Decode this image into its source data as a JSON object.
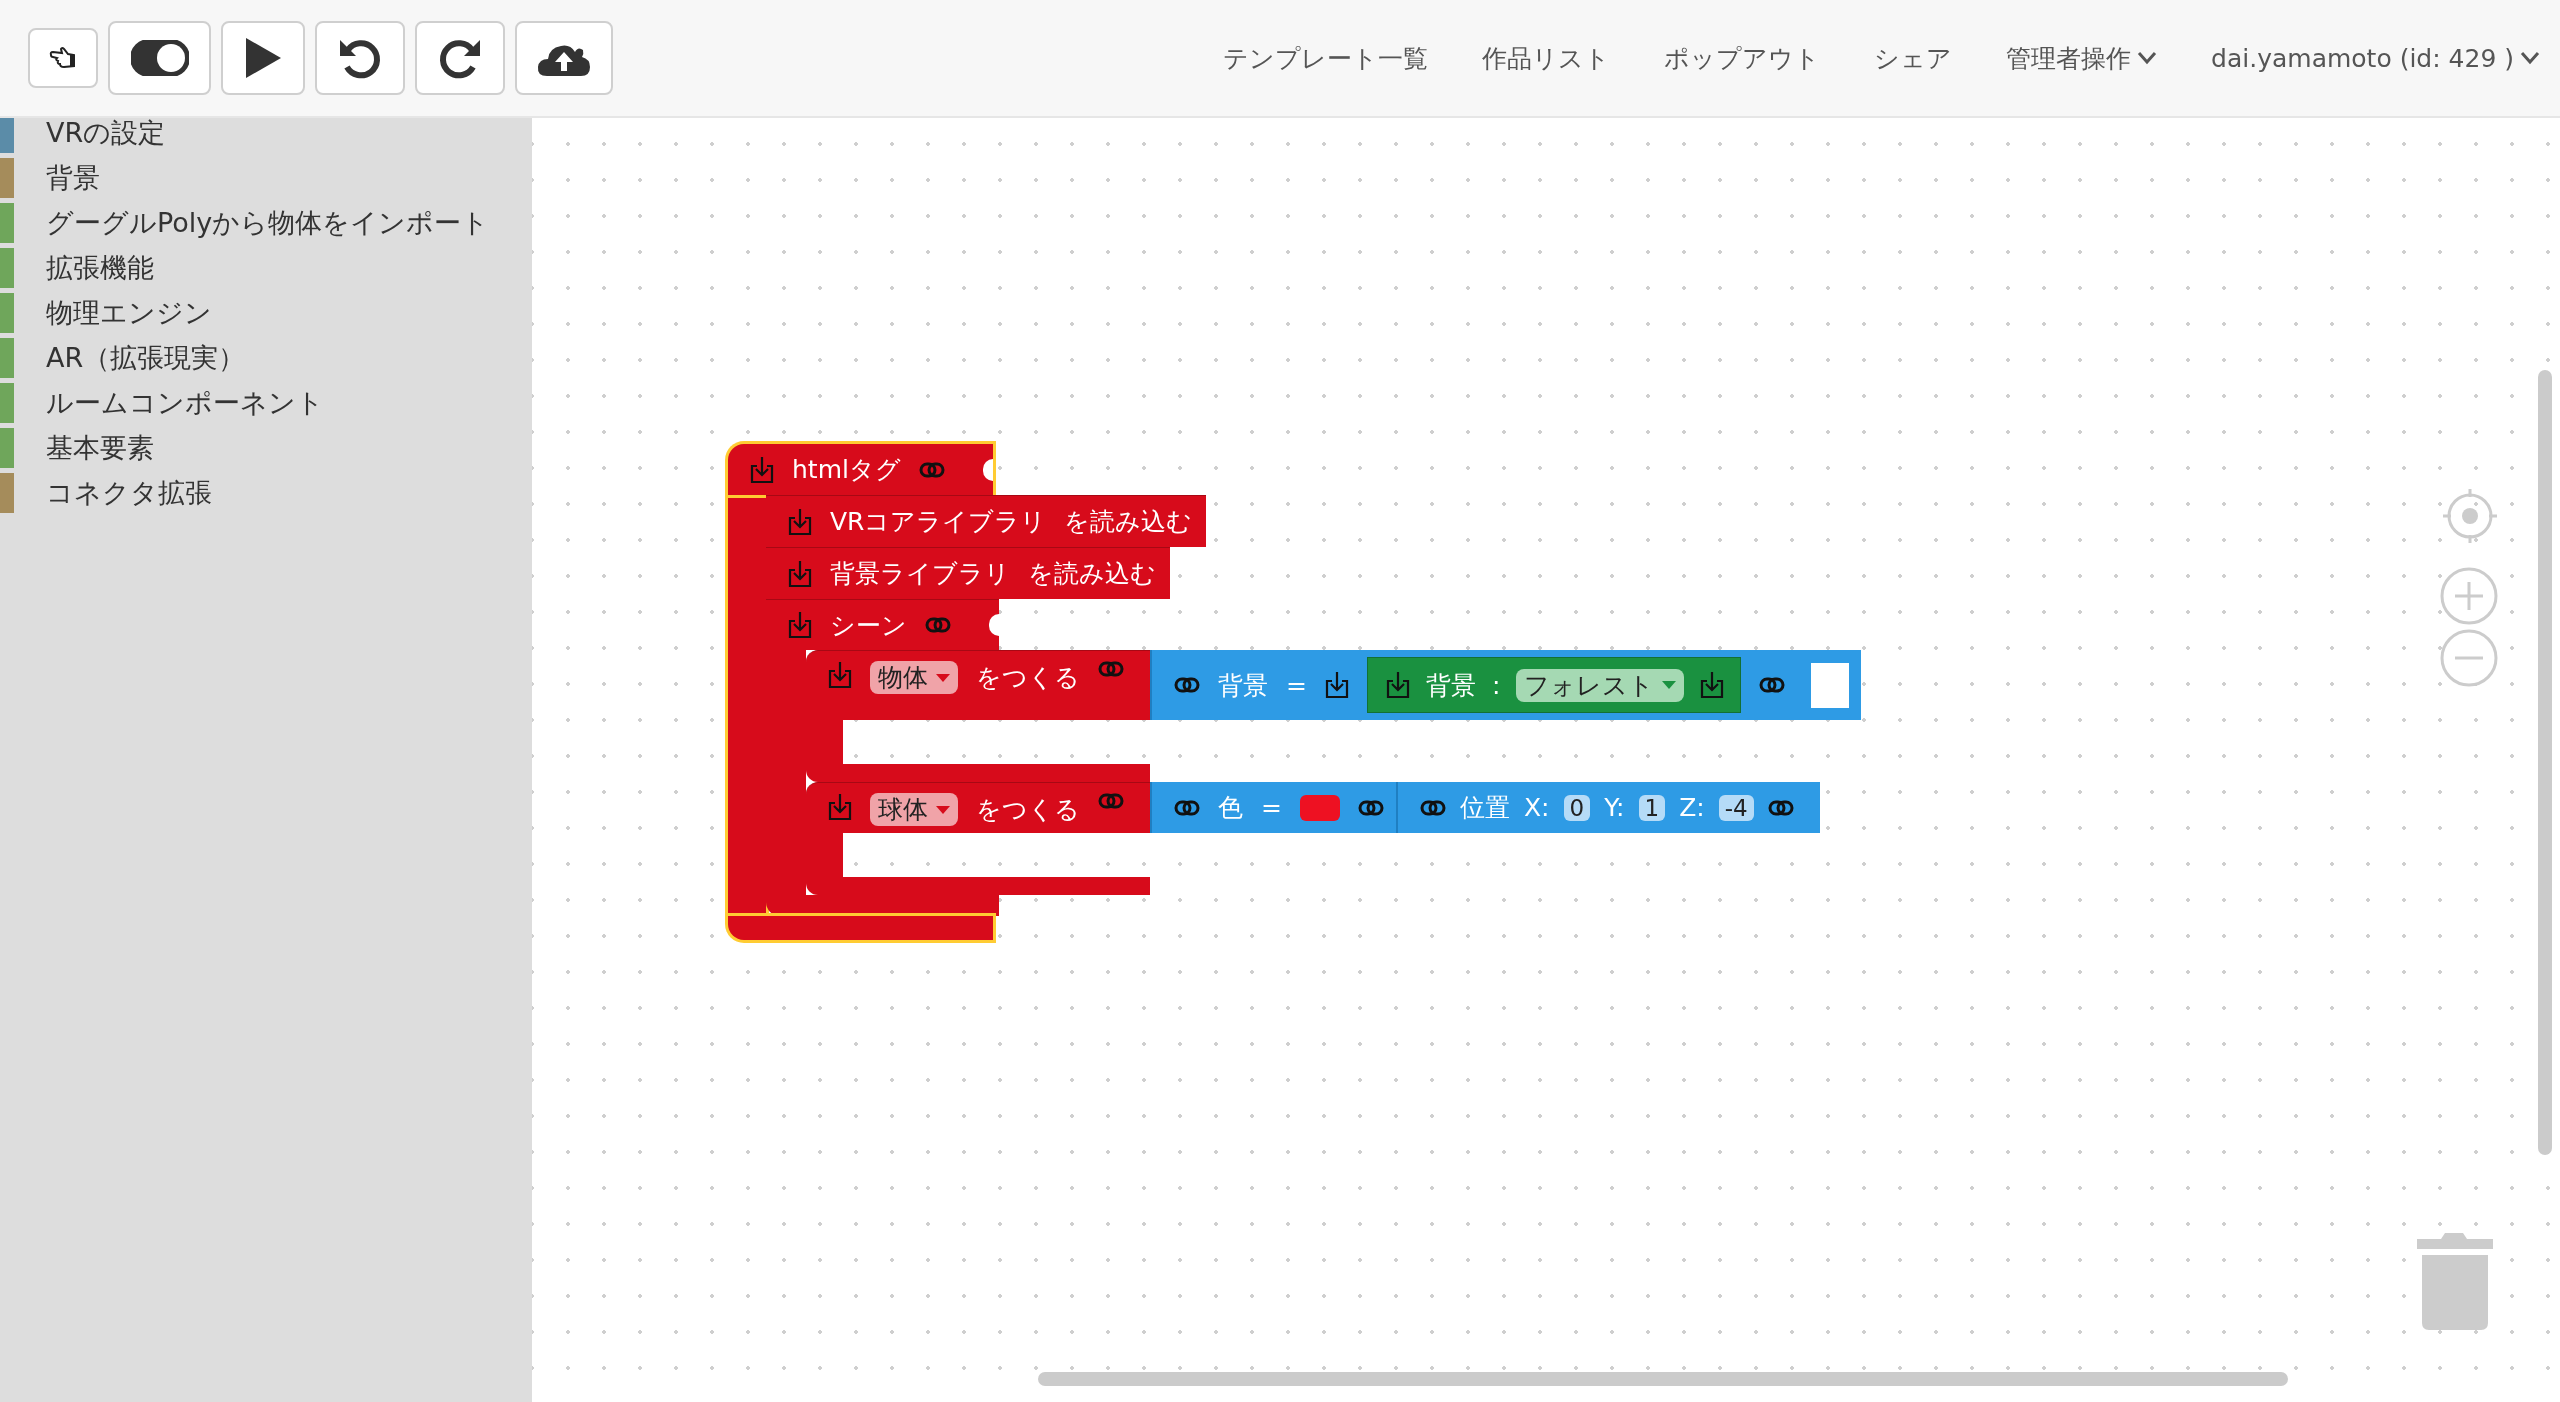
{
  "toolbar": {
    "toggle": {
      "on": true
    }
  },
  "nav": [
    {
      "label": "テンプレート一覧",
      "has_menu": false
    },
    {
      "label": "作品リスト",
      "has_menu": false
    },
    {
      "label": "ポップアウト",
      "has_menu": false
    },
    {
      "label": "シェア",
      "has_menu": false
    },
    {
      "label": "管理者操作",
      "has_menu": true
    },
    {
      "label": "dai.yamamoto (id: 429 )",
      "has_menu": true
    }
  ],
  "categories": [
    {
      "label": "VRの設定",
      "color": "#5b8ca8"
    },
    {
      "label": "背景",
      "color": "#a58c5b"
    },
    {
      "label": "グーグルPolyから物体をインポート",
      "color": "#6fa65b"
    },
    {
      "label": "拡張機能",
      "color": "#6fa65b"
    },
    {
      "label": "物理エンジン",
      "color": "#6fa65b"
    },
    {
      "label": "AR（拡張現実）",
      "color": "#6fa65b"
    },
    {
      "label": "ルームコンポーネント",
      "color": "#6fa65b"
    },
    {
      "label": "基本要素",
      "color": "#6fa65b"
    },
    {
      "label": "コネクタ拡張",
      "color": "#a58c5b"
    }
  ],
  "workspace": {
    "block": {
      "label": "htmlタグ",
      "selected": true,
      "statements": [
        {
          "kind": "load",
          "label": "VRコアライブラリ",
          "suffix": "を読み込む"
        },
        {
          "kind": "load",
          "label": "背景ライブラリ",
          "suffix": "を読み込む"
        },
        {
          "kind": "scene",
          "label": "シーン",
          "statements": [
            {
              "kind": "create",
              "option": "物体",
              "suffix": "をつくる",
              "inputs": [
                {
                  "kind": "assign",
                  "label": "背景",
                  "operator": "=",
                  "value": {
                    "label": "背景",
                    "separator": ":",
                    "option": "フォレスト"
                  }
                }
              ]
            },
            {
              "kind": "create",
              "option": "球体",
              "suffix": "をつくる",
              "inputs": [
                {
                  "kind": "color",
                  "label": "色",
                  "operator": "=",
                  "color": "#ee1122"
                },
                {
                  "kind": "position",
                  "label": "位置",
                  "fields": [
                    {
                      "name": "X:",
                      "value": "0"
                    },
                    {
                      "name": "Y:",
                      "value": "1"
                    },
                    {
                      "name": "Z:",
                      "value": "-4"
                    }
                  ]
                }
              ]
            }
          ]
        }
      ]
    }
  }
}
